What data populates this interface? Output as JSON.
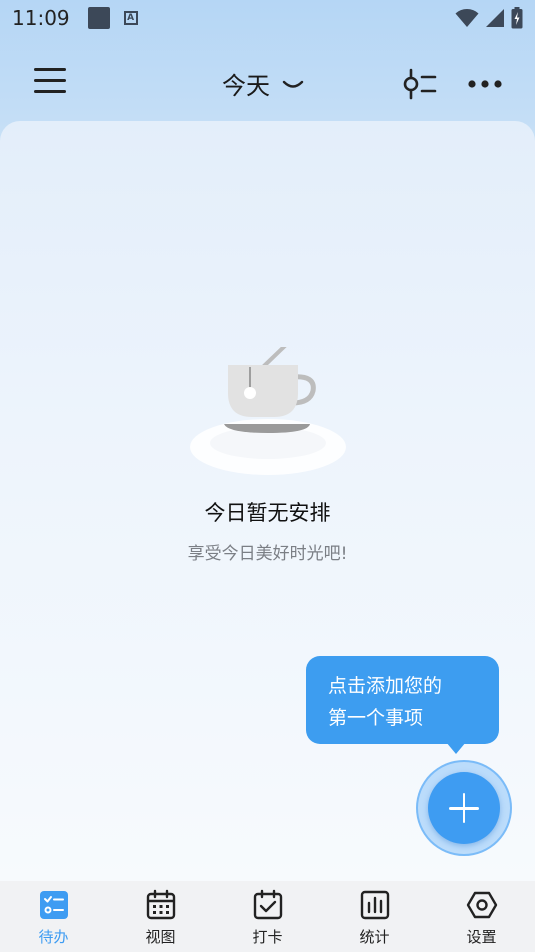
{
  "status_bar": {
    "time": "11:09",
    "notification_icons": [
      "square-notification-icon",
      "a-notification-icon"
    ],
    "system_icons": [
      "wifi-icon",
      "signal-icon",
      "battery-icon"
    ]
  },
  "header": {
    "title": "今天",
    "menu_icon": "hamburger-menu-icon",
    "filter_icon": "filter-icon",
    "more_icon": "more-icon"
  },
  "empty_state": {
    "illustration": "coffee-cup-icon",
    "title": "今日暂无安排",
    "subtitle": "享受今日美好时光吧!"
  },
  "tooltip": {
    "line1": "点击添加您的",
    "line2": "第一个事项"
  },
  "fab": {
    "icon": "plus-icon"
  },
  "bottom_nav": {
    "items": [
      {
        "label": "待办",
        "icon": "todo-icon",
        "active": true
      },
      {
        "label": "视图",
        "icon": "calendar-icon",
        "active": false
      },
      {
        "label": "打卡",
        "icon": "checkin-icon",
        "active": false
      },
      {
        "label": "统计",
        "icon": "stats-icon",
        "active": false
      },
      {
        "label": "设置",
        "icon": "settings-icon",
        "active": false
      }
    ]
  },
  "colors": {
    "accent": "#3e9cf2",
    "header_bg": "#b5d6f5",
    "nav_bg": "#f1f2f4",
    "text_primary": "#111111",
    "text_secondary": "#7b7f85"
  }
}
